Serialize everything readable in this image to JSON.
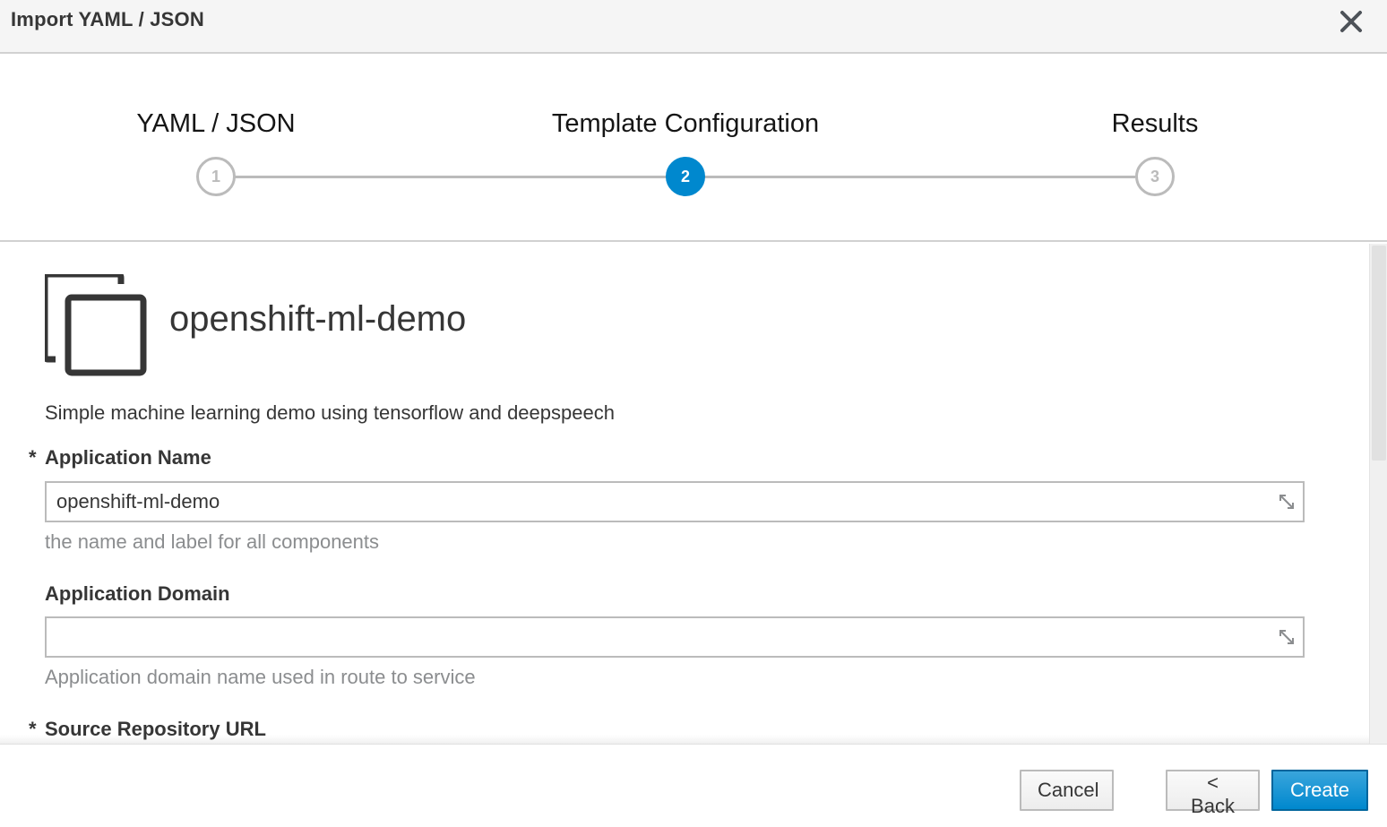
{
  "modal": {
    "title": "Import YAML / JSON"
  },
  "wizard": {
    "steps": [
      {
        "number": "1",
        "label": "YAML / JSON",
        "state": "visited"
      },
      {
        "number": "2",
        "label": "Template Configuration",
        "state": "active"
      },
      {
        "number": "3",
        "label": "Results",
        "state": "upcoming"
      }
    ],
    "active_color": "#0088ce",
    "inactive_color": "#bbbbbb"
  },
  "template": {
    "icon": "template-copy-icon",
    "name": "openshift-ml-demo",
    "description": "Simple machine learning demo using tensorflow and deepspeech"
  },
  "fields": [
    {
      "required_mark": "*",
      "label": "Application Name",
      "value": "openshift-ml-demo",
      "help": "the name and label for all components"
    },
    {
      "required_mark": "",
      "label": "Application Domain",
      "value": "",
      "help": "Application domain name used in route to service"
    },
    {
      "required_mark": "*",
      "label": "Source Repository URL"
    }
  ],
  "footer": {
    "cancel_label": "Cancel",
    "back_label": "< Back",
    "create_label": "Create"
  }
}
